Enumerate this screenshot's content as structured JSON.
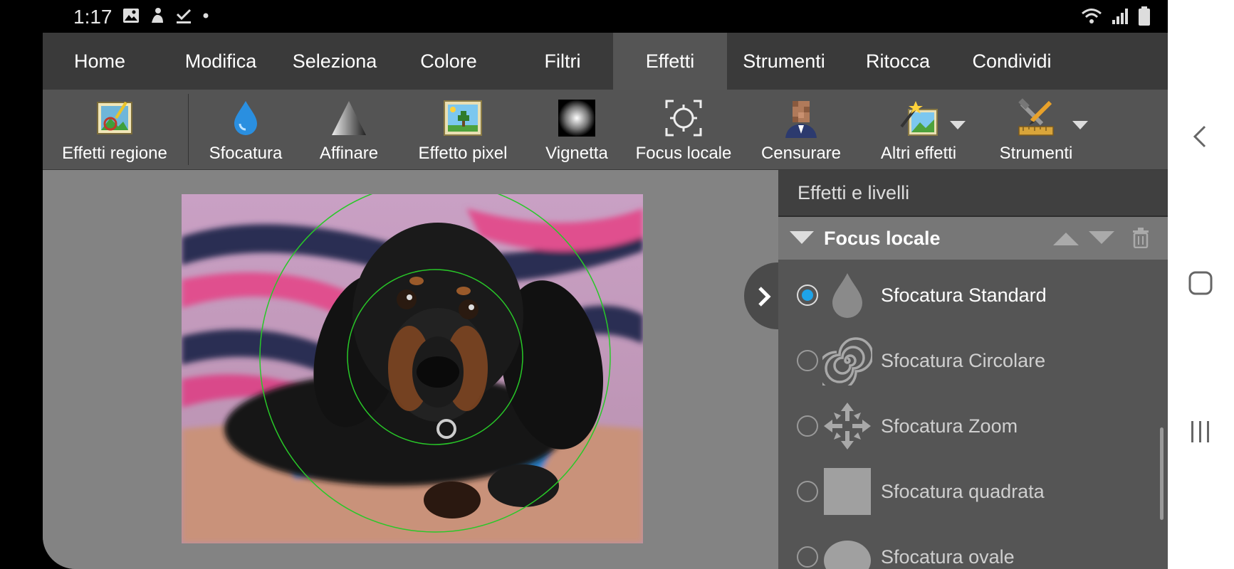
{
  "status": {
    "time": "1:17",
    "icons": [
      "image-icon",
      "person-icon",
      "check-icon",
      "dot-icon"
    ],
    "right_icons": [
      "wifi-icon",
      "signal-icon",
      "battery-icon"
    ]
  },
  "menu": {
    "tabs": [
      "Home",
      "Modifica",
      "Seleziona",
      "Colore",
      "Filtri",
      "Effetti",
      "Strumenti",
      "Ritocca",
      "Condividi"
    ],
    "active": "Effetti"
  },
  "ribbon": {
    "buttons": [
      "Effetti regione",
      "Sfocatura",
      "Affinare",
      "Effetto pixel",
      "Vignetta",
      "Focus locale",
      "Censurare",
      "Altri effetti",
      "Strumenti"
    ]
  },
  "panel": {
    "title": "Effetti e livelli",
    "group": "Focus locale",
    "items": [
      "Sfocatura Standard",
      "Sfocatura Circolare",
      "Sfocatura Zoom",
      "Sfocatura quadrata",
      "Sfocatura ovale"
    ],
    "selected": "Sfocatura Standard"
  },
  "colors": {
    "accent": "#1ea3e8",
    "menubar": "#3a3a3a",
    "ribbon": "#545454",
    "panel": "#555555"
  }
}
